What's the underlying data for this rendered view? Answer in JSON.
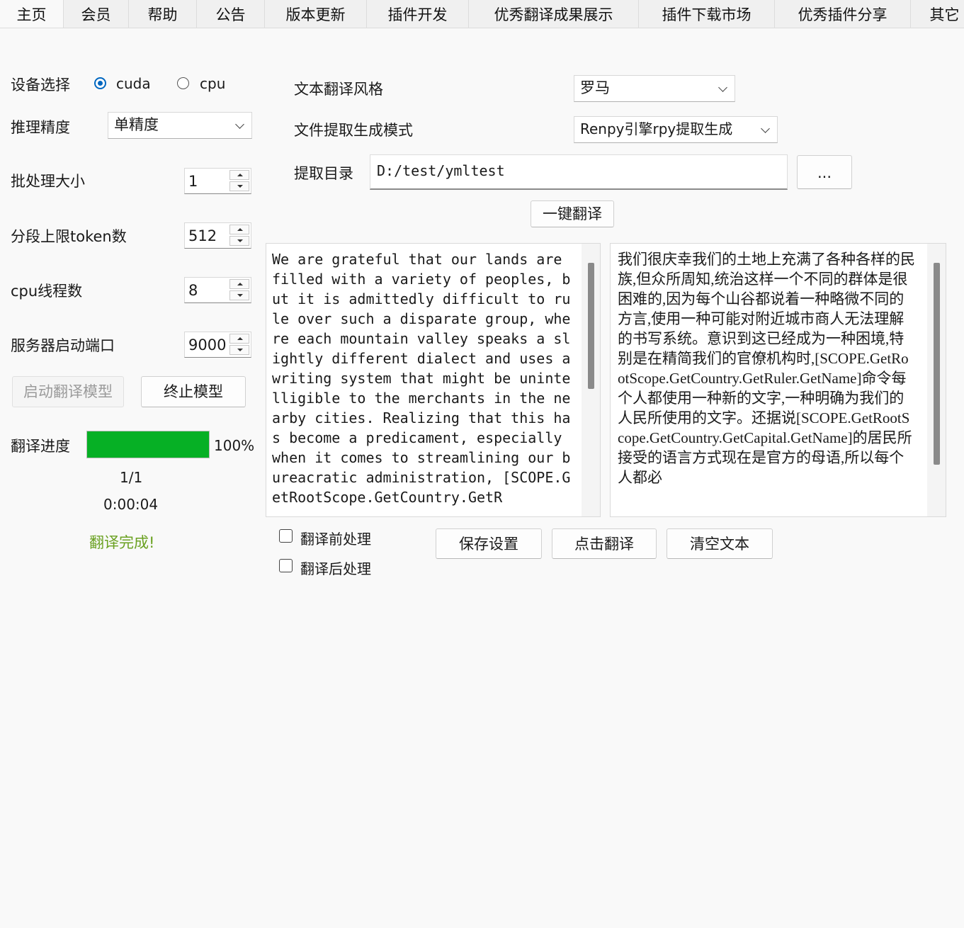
{
  "tabs": [
    {
      "label": "主页",
      "active": true
    },
    {
      "label": "会员"
    },
    {
      "label": "帮助"
    },
    {
      "label": "公告"
    },
    {
      "label": "版本更新"
    },
    {
      "label": "插件开发"
    },
    {
      "label": "优秀翻译成果展示"
    },
    {
      "label": "插件下载市场"
    },
    {
      "label": "优秀插件分享"
    },
    {
      "label": "其它"
    }
  ],
  "settings": {
    "device_label": "设备选择",
    "device_options": [
      "cuda",
      "cpu"
    ],
    "device_selected": "cuda",
    "precision_label": "推理精度",
    "precision_value": "单精度",
    "batch_label": "批处理大小",
    "batch_value": "1",
    "token_label": "分段上限token数",
    "token_value": "512",
    "threads_label": "cpu线程数",
    "threads_value": "8",
    "port_label": "服务器启动端口",
    "port_value": "9000",
    "start_button": "启动翻译模型",
    "stop_button": "终止模型"
  },
  "progress": {
    "label": "翻译进度",
    "percent": 100,
    "percent_text": "100%",
    "count": "1/1",
    "time": "0:00:04",
    "status": "翻译完成!",
    "bar_color": "#06b025",
    "status_color": "#6aa121"
  },
  "right": {
    "style_label": "文本翻译风格",
    "style_value": "罗马",
    "mode_label": "文件提取生成模式",
    "mode_value": "Renpy引擎rpy提取生成",
    "dir_label": "提取目录",
    "dir_value": "D:/test/ymltest",
    "browse_button": "...",
    "one_click_button": "一键翻译"
  },
  "source_text": "We are grateful that our lands are filled with a variety of peoples, but it is admittedly difficult to rule over such a disparate group, where each mountain valley speaks a slightly different dialect and uses a writing system that might be unintelligible to the merchants in the nearby cities. Realizing that this has become a predicament, especially when it comes to streamlining our bureacratic administration, [SCOPE.GetRootScope.GetCountry.GetR",
  "target_text": "我们很庆幸我们的土地上充满了各种各样的民族,但众所周知,统治这样一个不同的群体是很困难的,因为每个山谷都说着一种略微不同的方言,使用一种可能对附近城市商人无法理解的书写系统。意识到这已经成为一种困境,特别是在精简我们的官僚机构时,[SCOPE.GetRootScope.GetCountry.GetRuler.GetName]命令每个人都使用一种新的文字,一种明确为我们的人民所使用的文字。还据说[SCOPE.GetRootScope.GetCountry.GetCapital.GetName]的居民所接受的语言方式现在是官方的母语,所以每个人都必",
  "bottom": {
    "pre_label": "翻译前处理",
    "post_label": "翻译后处理",
    "save_button": "保存设置",
    "translate_button": "点击翻译",
    "clear_button": "清空文本"
  }
}
